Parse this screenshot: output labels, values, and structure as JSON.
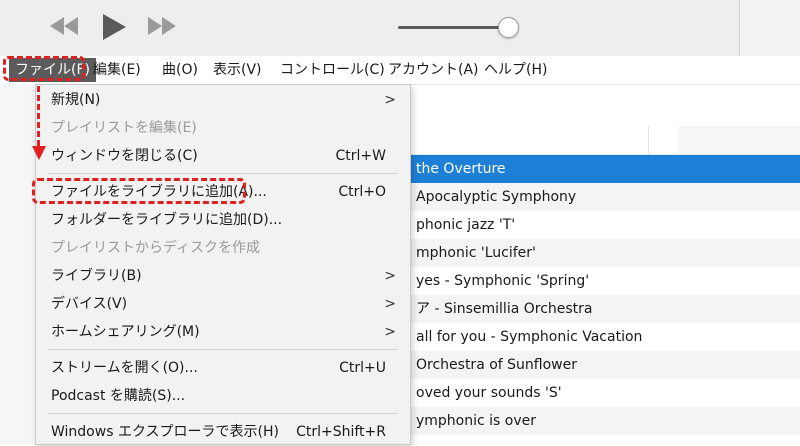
{
  "menubar": {
    "items": [
      "ファイル(F)",
      "編集(E)",
      "曲(O)",
      "表示(V)",
      "コントロール(C)",
      "アカウント(A)",
      "ヘルプ(H)"
    ]
  },
  "player": {
    "icons": [
      "rewind-icon",
      "play-icon",
      "fast-forward-icon"
    ],
    "volume_level": 0.92
  },
  "file_menu": {
    "new_label": "新規(N)",
    "edit_playlist_label": "プレイリストを編集(E)",
    "close_window_label": "ウィンドウを閉じる(C)",
    "close_window_shortcut": "Ctrl+W",
    "add_file_label": "ファイルをライブラリに追加(A)...",
    "add_file_shortcut": "Ctrl+O",
    "add_folder_label": "フォルダーをライブラリに追加(D)...",
    "burn_playlist_label": "プレイリストからディスクを作成",
    "library_label": "ライブラリ(B)",
    "devices_label": "デバイス(V)",
    "home_sharing_label": "ホームシェアリング(M)",
    "open_stream_label": "ストリームを開く(O)...",
    "open_stream_shortcut": "Ctrl+U",
    "podcast_label": "Podcast を購読(S)...",
    "show_in_explorer_label": "Windows エクスプローラで表示(H)",
    "show_in_explorer_shortcut": "Ctrl+Shift+R",
    "submenu_arrow": ">"
  },
  "tracks": [
    "the Overture",
    "Apocalyptic Symphony",
    "phonic jazz 'T'",
    "mphonic 'Lucifer'",
    "yes - Symphonic 'Spring'",
    "ア - Sinsemillia Orchestra",
    "all for you - Symphonic Vacation",
    "Orchestra of Sunflower",
    "oved your sounds 'S'",
    "ymphonic is over"
  ],
  "colors": {
    "selection": "#1e7fd6",
    "annotation": "#e0201e",
    "menu_active": "#5b5b5b"
  }
}
